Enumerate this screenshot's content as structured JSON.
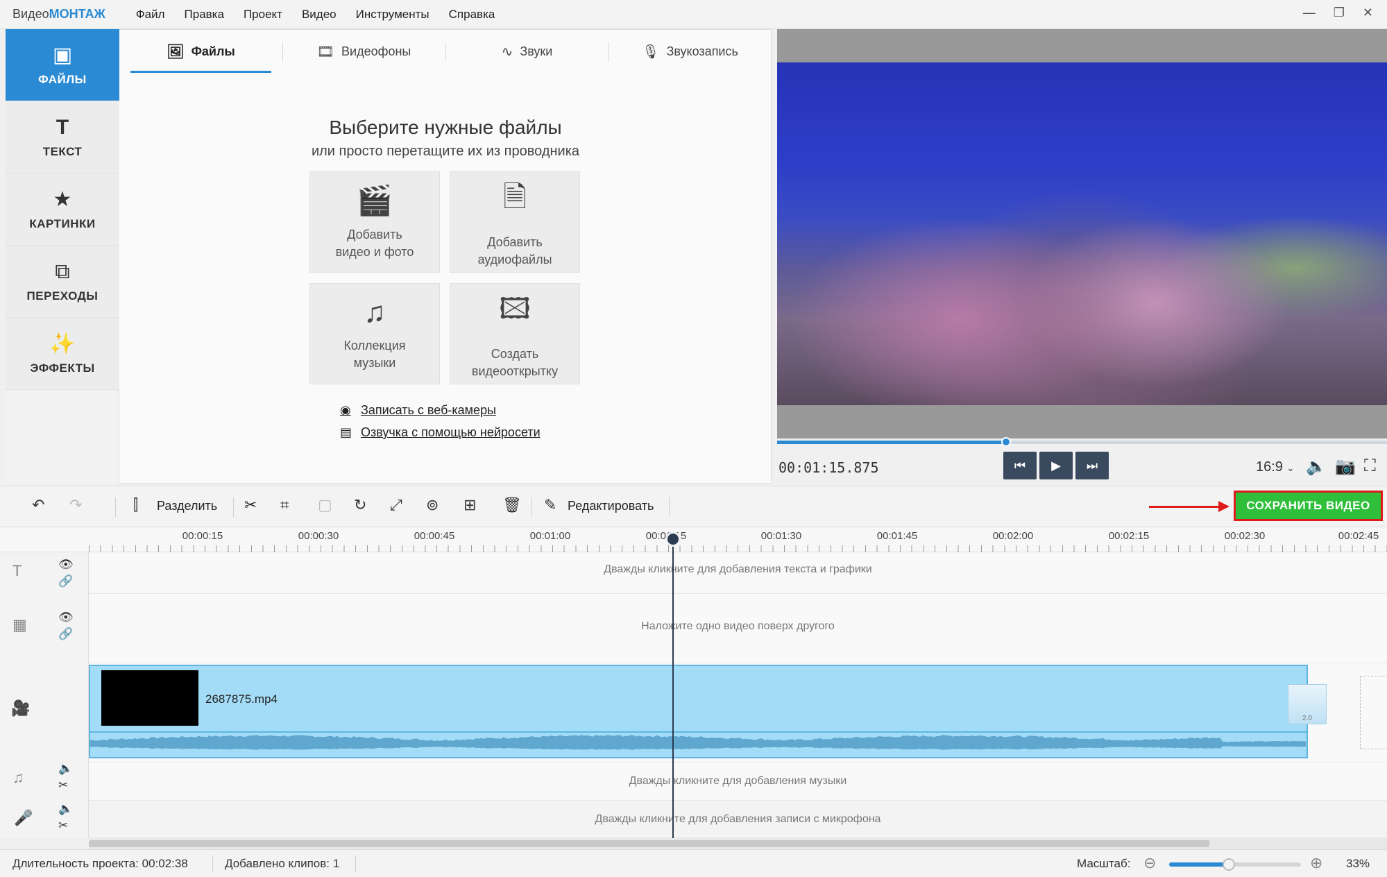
{
  "app": {
    "logo_part1": "Видео",
    "logo_part2": "МОНТАЖ",
    "menu": [
      "Файл",
      "Правка",
      "Проект",
      "Видео",
      "Инструменты",
      "Справка"
    ]
  },
  "sidebar": {
    "items": [
      {
        "label": "ФАЙЛЫ",
        "icon": "image-icon",
        "active": true
      },
      {
        "label": "ТЕКСТ",
        "icon": "text-icon"
      },
      {
        "label": "КАРТИНКИ",
        "icon": "star-icon"
      },
      {
        "label": "ПЕРЕХОДЫ",
        "icon": "transitions-icon"
      },
      {
        "label": "ЭФФЕКТЫ",
        "icon": "magic-wand-icon"
      }
    ]
  },
  "panel": {
    "tabs": [
      {
        "label": "Файлы",
        "icon": "image-icon",
        "active": true
      },
      {
        "label": "Видеофоны",
        "icon": "film-icon"
      },
      {
        "label": "Звуки",
        "icon": "waveform-icon"
      },
      {
        "label": "Звукозапись",
        "icon": "microphone-icon"
      }
    ],
    "title": "Выберите нужные файлы",
    "subtitle": "или просто перетащите их из проводника",
    "tiles": [
      {
        "line1": "Добавить",
        "line2": "видео и фото",
        "icon": "film-reel-icon"
      },
      {
        "line1": "Добавить",
        "line2": "аудиофайлы",
        "icon": "audio-file-icon"
      },
      {
        "line1": "Коллекция",
        "line2": "музыки",
        "icon": "music-notes-icon"
      },
      {
        "line1": "Создать",
        "line2": "видеооткрытку",
        "icon": "postcard-icon"
      }
    ],
    "links": [
      {
        "label": "Записать с веб-камеры",
        "icon": "webcam-icon"
      },
      {
        "label": "Озвучка с помощью нейросети",
        "icon": "ai-voice-icon"
      }
    ]
  },
  "preview": {
    "timecode": "00:01:15.875",
    "aspect_ratio": "16:9",
    "progress": 0.375
  },
  "toolbar": {
    "split_label": "Разделить",
    "edit_label": "Редактировать",
    "save_label": "СОХРАНИТЬ ВИДЕО",
    "accent_color": "#2fbf3a",
    "highlight_color": "#e01b1b"
  },
  "timeline": {
    "ticks": [
      "00:00:15",
      "00:00:30",
      "00:00:45",
      "00:01:00",
      "00:01:15",
      "00:01:30",
      "00:01:45",
      "00:02:00",
      "00:02:15",
      "00:02:30",
      "00:02:45"
    ],
    "hint_text": "Дважды кликните для добавления текста и графики",
    "hint_overlay": "Наложите одно видео поверх другого",
    "hint_music": "Дважды кликните для добавления музыки",
    "hint_mic": "Дважды кликните для добавления записи с микрофона",
    "clip_name": "2687875.mp4",
    "transition_label": "2.0"
  },
  "status": {
    "duration_label": "Длительность проекта:",
    "duration_value": "00:02:38",
    "clips_label": "Добавлено клипов:",
    "clips_value": "1",
    "zoom_label": "Масштаб:",
    "zoom_value": "33%",
    "zoom_fraction": 0.45
  }
}
